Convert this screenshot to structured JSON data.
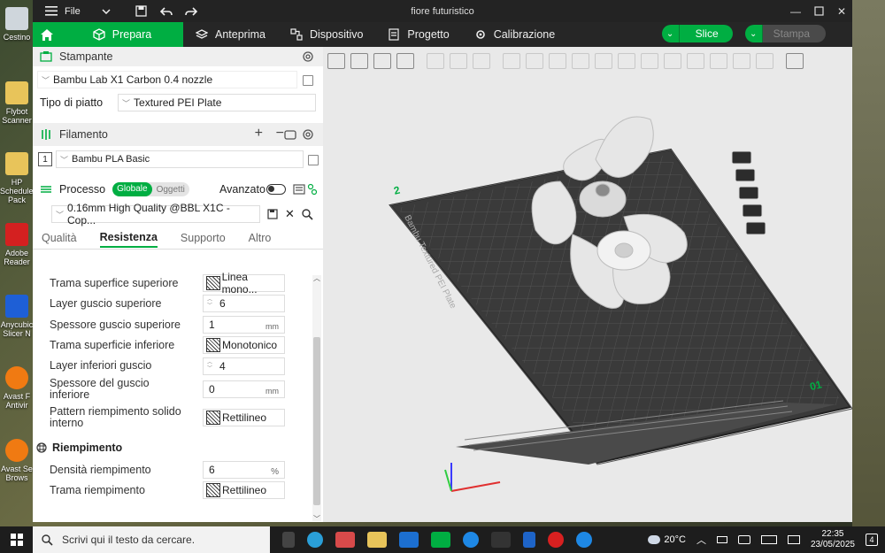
{
  "desktop": {
    "icons": [
      "Cestino",
      "Flybot Scanner",
      "HP Scheduler Pack",
      "Adobe Reader",
      "Anycubic Slicer N",
      "Avast F Antivir",
      "Avast Se Brows"
    ]
  },
  "titlebar": {
    "file_label": "File",
    "title": "fiore futuristico"
  },
  "nav": {
    "tabs": [
      "Prepara",
      "Anteprima",
      "Dispositivo",
      "Progetto",
      "Calibrazione"
    ],
    "slice_label": "Slice",
    "print_label": "Stampa"
  },
  "printer": {
    "header": "Stampante",
    "preset": "Bambu Lab X1 Carbon 0.4 nozzle",
    "plate_label": "Tipo di piatto",
    "plate_value": "Textured PEI Plate"
  },
  "filament": {
    "header": "Filamento",
    "slot": "1",
    "value": "Bambu PLA Basic"
  },
  "process": {
    "header": "Processo",
    "toggle_global": "Globale",
    "toggle_objects": "Oggetti",
    "advanced_label": "Avanzato",
    "preset": "0.16mm High Quality @BBL X1C - Cop...",
    "tabs": [
      "Qualità",
      "Resistenza",
      "Supporto",
      "Altro"
    ],
    "params": [
      {
        "label": "Trama superfice superiore",
        "value": "Linea mono...",
        "unit": ""
      },
      {
        "label": "Layer guscio superiore",
        "value": "6",
        "unit": ""
      },
      {
        "label": "Spessore guscio superiore",
        "value": "1",
        "unit": "mm"
      },
      {
        "label": "Trama superficie inferiore",
        "value": "Monotonico",
        "unit": ""
      },
      {
        "label": "Layer inferiori guscio",
        "value": "4",
        "unit": ""
      },
      {
        "label": "Spessore del guscio inferiore",
        "value": "0",
        "unit": "mm"
      },
      {
        "label": "Pattern riempimento solido interno",
        "value": "Rettilineo",
        "unit": ""
      }
    ],
    "infill_header": "Riempimento",
    "infill_params": [
      {
        "label": "Densità riempimento",
        "value": "6",
        "unit": "%"
      },
      {
        "label": "Trama riempimento",
        "value": "Rettilineo",
        "unit": ""
      }
    ]
  },
  "viewport": {
    "plate_label": "Bambu Textured PEI Plate",
    "plate_number": "01",
    "corner_mark": "2"
  },
  "taskbar": {
    "search_placeholder": "Scrivi qui il testo da cercare.",
    "weather": "20°C",
    "time": "22:35",
    "date": "23/05/2025",
    "notifications": "4"
  },
  "colors": {
    "accent": "#00ae42",
    "titlebar": "#232323",
    "viewport_bg": "#e9e9e9",
    "plate": "#3a3a3a"
  }
}
